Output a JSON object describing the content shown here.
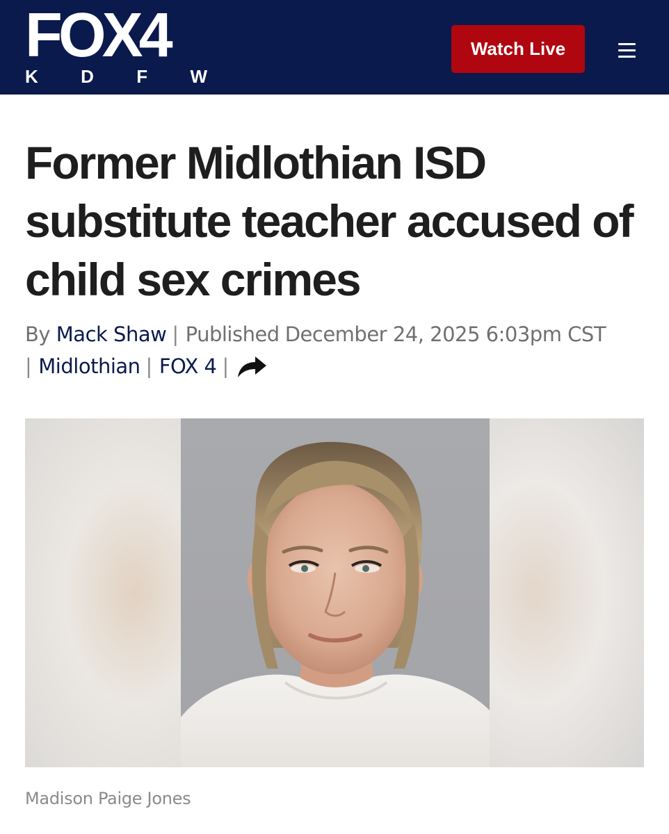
{
  "header": {
    "logo_main": "FOX4",
    "logo_letters": [
      "K",
      "D",
      "F",
      "W"
    ],
    "watch_live_label": "Watch Live",
    "menu_icon": "hamburger-menu-icon",
    "background_color": "#0b1a4d",
    "accent_color": "#b0060f"
  },
  "article": {
    "headline": "Former Midlothian ISD substitute teacher accused of child sex crimes",
    "byline": {
      "by_label": "By",
      "author": "Mack Shaw",
      "published_label": "Published",
      "date": "December 24, 2025 6:03pm CST",
      "tag": "Midlothian",
      "source": "FOX 4",
      "share_icon": "share-arrow-icon"
    },
    "image": {
      "caption": "Madison Paige Jones"
    }
  }
}
